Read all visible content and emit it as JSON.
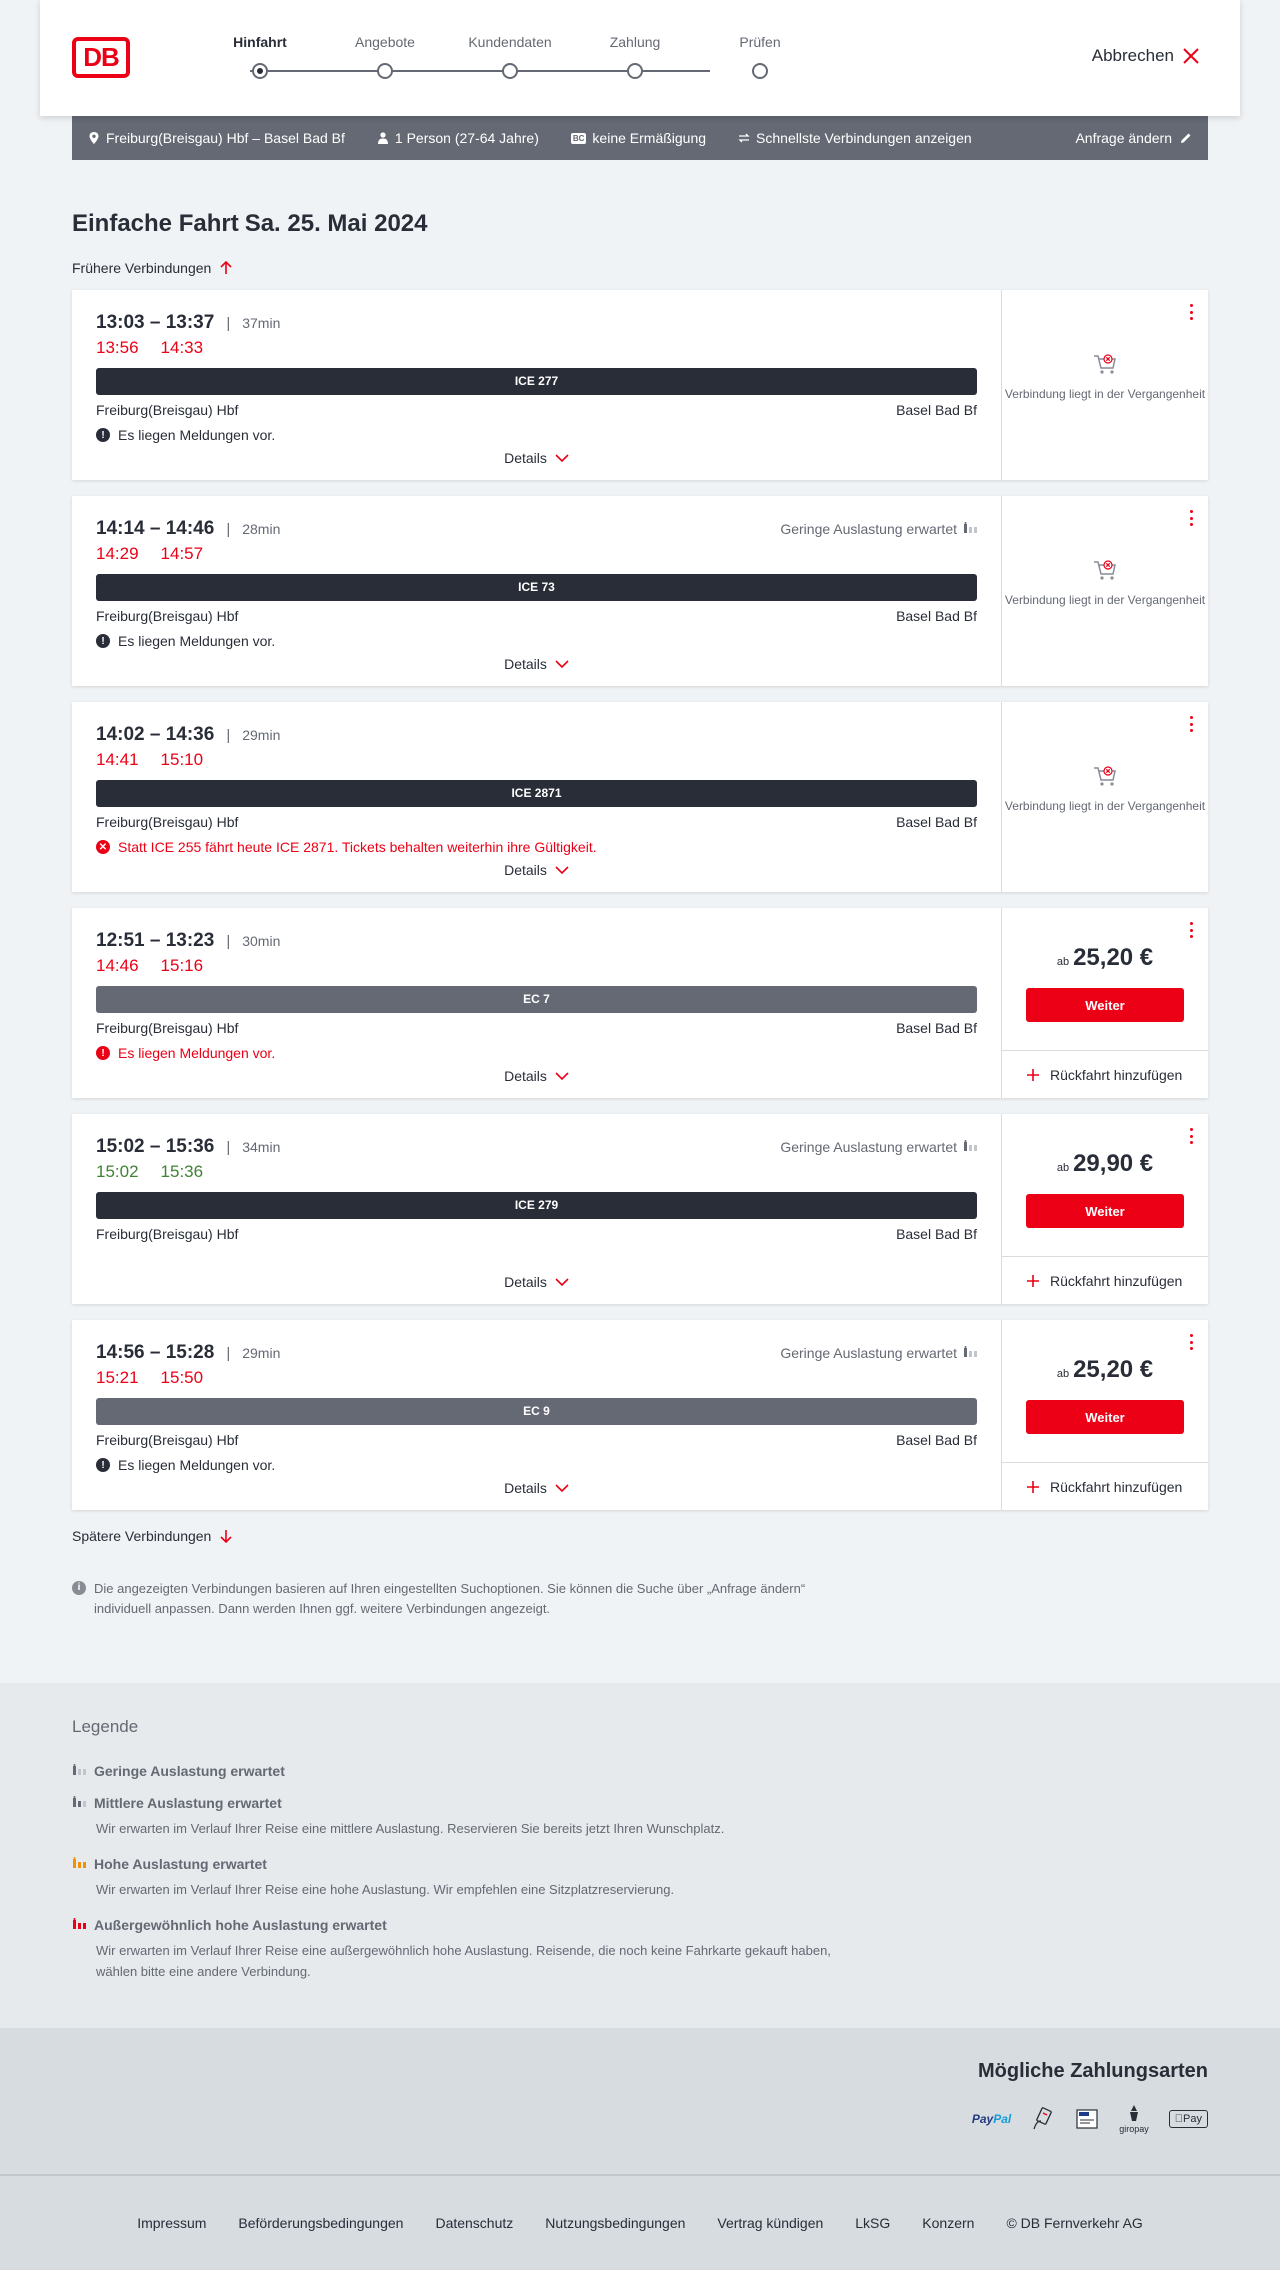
{
  "header": {
    "logo_text": "DB",
    "steps": [
      "Hinfahrt",
      "Angebote",
      "Kundendaten",
      "Zahlung",
      "Prüfen"
    ],
    "active_step": "Hinfahrt",
    "cancel_label": "Abbrechen"
  },
  "query": {
    "route": "Freiburg(Breisgau) Hbf – Basel Bad Bf",
    "passengers": "1 Person (27-64 Jahre)",
    "discount_badge": "BC",
    "discount": "keine Ermäßigung",
    "fastest": "Schnellste Verbindungen anzeigen",
    "change_label": "Anfrage ändern"
  },
  "headline": {
    "type": "Einfache Fahrt",
    "date": "Sa. 25. Mai 2024"
  },
  "earlier_label": "Frühere Verbindungen",
  "later_label": "Spätere Verbindungen",
  "details_label": "Details",
  "weiter_label": "Weiter",
  "return_label": "Rückfahrt hinzufügen",
  "past_label": "Verbindung liegt in der Vergangenheit",
  "price_prefix": "ab",
  "connections": [
    {
      "times": "13:03 – 13:37",
      "duration": "37min",
      "occupancy": "",
      "rt_dep": "13:56",
      "rt_arr": "14:33",
      "rt_status": "late",
      "train": "ICE 277",
      "train_type": "ice",
      "from": "Freiburg(Breisgau) Hbf",
      "to": "Basel Bad Bf",
      "message": "Es liegen Meldungen vor.",
      "message_type": "info",
      "offer": "past",
      "price": ""
    },
    {
      "times": "14:14 – 14:46",
      "duration": "28min",
      "occupancy": "Geringe Auslastung erwartet",
      "rt_dep": "14:29",
      "rt_arr": "14:57",
      "rt_status": "late",
      "train": "ICE 73",
      "train_type": "ice",
      "from": "Freiburg(Breisgau) Hbf",
      "to": "Basel Bad Bf",
      "message": "Es liegen Meldungen vor.",
      "message_type": "info",
      "offer": "past",
      "price": ""
    },
    {
      "times": "14:02 – 14:36",
      "duration": "29min",
      "occupancy": "",
      "rt_dep": "14:41",
      "rt_arr": "15:10",
      "rt_status": "late",
      "train": "ICE 2871",
      "train_type": "ice",
      "from": "Freiburg(Breisgau) Hbf",
      "to": "Basel Bad Bf",
      "message": "Statt ICE 255 fährt heute ICE 2871. Tickets behalten weiterhin ihre Gültigkeit.",
      "message_type": "error",
      "offer": "past",
      "price": ""
    },
    {
      "times": "12:51 – 13:23",
      "duration": "30min",
      "occupancy": "",
      "rt_dep": "14:46",
      "rt_arr": "15:16",
      "rt_status": "late",
      "train": "EC 7",
      "train_type": "ec",
      "from": "Freiburg(Breisgau) Hbf",
      "to": "Basel Bad Bf",
      "message": "Es liegen Meldungen vor.",
      "message_type": "warning",
      "offer": "price",
      "price": "25,20 €"
    },
    {
      "times": "15:02 – 15:36",
      "duration": "34min",
      "occupancy": "Geringe Auslastung erwartet",
      "rt_dep": "15:02",
      "rt_arr": "15:36",
      "rt_status": "ontime",
      "train": "ICE 279",
      "train_type": "ice",
      "from": "Freiburg(Breisgau) Hbf",
      "to": "Basel Bad Bf",
      "message": "",
      "message_type": "none",
      "offer": "price",
      "price": "29,90 €"
    },
    {
      "times": "14:56 – 15:28",
      "duration": "29min",
      "occupancy": "Geringe Auslastung erwartet",
      "rt_dep": "15:21",
      "rt_arr": "15:50",
      "rt_status": "late",
      "train": "EC 9",
      "train_type": "ec",
      "from": "Freiburg(Breisgau) Hbf",
      "to": "Basel Bad Bf",
      "message": "Es liegen Meldungen vor.",
      "message_type": "info",
      "offer": "price",
      "price": "25,20 €"
    }
  ],
  "note": "Die angezeigten Verbindungen basieren auf Ihren eingestellten Suchoptionen. Sie können die Suche über „Anfrage ändern“ individuell anpassen. Dann werden Ihnen ggf. weitere Verbindungen angezeigt.",
  "legend": {
    "title": "Legende",
    "items": [
      {
        "title": "Geringe Auslastung erwartet",
        "desc": "",
        "color": "#646973"
      },
      {
        "title": "Mittlere Auslastung erwartet",
        "desc": "Wir erwarten im Verlauf Ihrer Reise eine mittlere Auslastung. Reservieren Sie bereits jetzt Ihren Wunschplatz.",
        "color": "#646973"
      },
      {
        "title": "Hohe Auslastung erwartet",
        "desc": "Wir erwarten im Verlauf Ihrer Reise eine hohe Auslastung. Wir empfehlen eine Sitzplatzreservierung.",
        "color": "#f39200"
      },
      {
        "title": "Außergewöhnlich hohe Auslastung erwartet",
        "desc": "Wir erwarten im Verlauf Ihrer Reise eine außergewöhnlich hohe Auslastung. Reisende, die noch keine Fahrkarte gekauft haben, wählen bitte eine andere Verbindung.",
        "color": "#ec0016"
      }
    ]
  },
  "payment": {
    "title": "Mögliche Zahlungsarten",
    "paypal_a": "Pay",
    "paypal_b": "Pal",
    "giropay": "giropay",
    "applepay": "Pay"
  },
  "footer": [
    "Impressum",
    "Beförderungsbedingungen",
    "Datenschutz",
    "Nutzungsbedingungen",
    "Vertrag kündigen",
    "LkSG",
    "Konzern",
    "© DB Fernverkehr AG"
  ]
}
